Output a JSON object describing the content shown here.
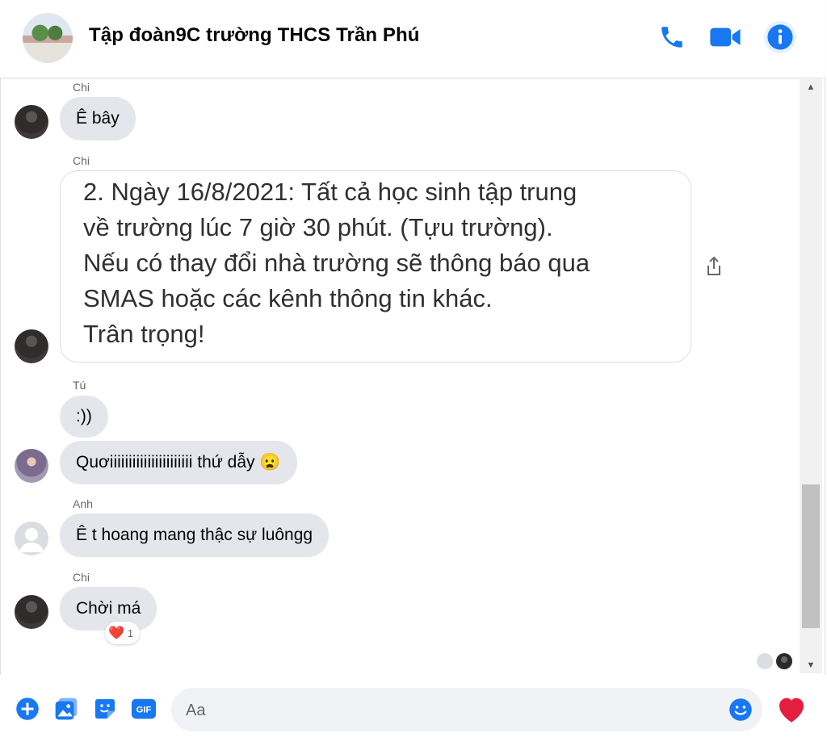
{
  "header": {
    "title": "Tập đoàn9C trường THCS Trần Phú"
  },
  "messages": [
    {
      "sender": "Chi",
      "text": "Ê bây"
    },
    {
      "sender": "Chi",
      "image_text": [
        "2. Ngày 16/8/2021: Tất cả học sinh tập trung",
        "về trường lúc 7 giờ 30 phút. (Tựu trường).",
        "Nếu có thay đổi nhà trường sẽ thông báo qua",
        "SMAS hoặc các kênh thông tin khác.",
        "Trân trọng!"
      ]
    },
    {
      "sender": "Tú",
      "text": ":))"
    },
    {
      "sender": "",
      "text": "Quơiiiiiiiiiiiiiiiiiiiiii thứ dẫy 😦"
    },
    {
      "sender": "Anh",
      "text": "Ê t hoang mang thậc sự luôngg"
    },
    {
      "sender": "Chi",
      "text": "Chời má",
      "reaction": {
        "emoji": "❤️",
        "count": "1"
      }
    }
  ],
  "composer": {
    "placeholder": "Aa"
  },
  "colors": {
    "accent": "#1877f2",
    "bubble": "#e4e6eb",
    "like_heart": "#e41e3f"
  },
  "icons": [
    "phone-icon",
    "video-icon",
    "info-icon",
    "share-icon",
    "plus-icon",
    "photo-icon",
    "sticker-icon",
    "gif-icon",
    "emoji-icon",
    "heart-icon"
  ]
}
